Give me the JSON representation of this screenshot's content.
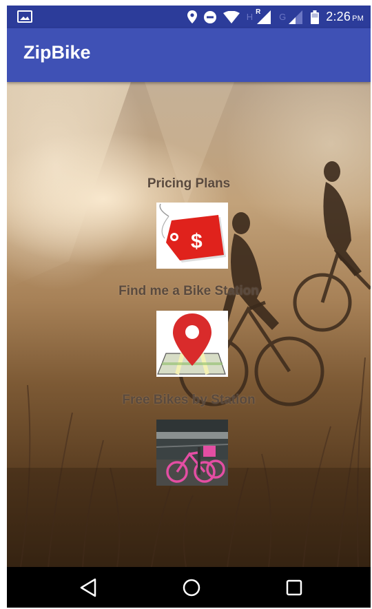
{
  "status_bar": {
    "time": "2:26",
    "ampm": "PM",
    "network_h": "H",
    "network_r": "R",
    "network_g": "G",
    "icons": [
      "image-notification-icon",
      "location-icon",
      "do-not-disturb-icon",
      "wifi-icon",
      "signal-icon",
      "signal-weak-icon",
      "battery-icon"
    ]
  },
  "app_bar": {
    "title": "ZipBike"
  },
  "menu": [
    {
      "label": "Pricing Plans",
      "icon": "price-tag-icon"
    },
    {
      "label": "Find me a Bike Station",
      "icon": "map-pin-icon"
    },
    {
      "label": "Free Bikes by Station",
      "icon": "pink-bikes-photo"
    }
  ],
  "nav_bar": {
    "icons": [
      "back-icon",
      "home-icon",
      "recents-icon"
    ]
  },
  "colors": {
    "status_bar": "#2c3c9a",
    "app_bar": "#3f51b5",
    "label_text": "#5a4a3e",
    "price_tag_red": "#e0221c",
    "pin_red": "#d92b2b"
  }
}
